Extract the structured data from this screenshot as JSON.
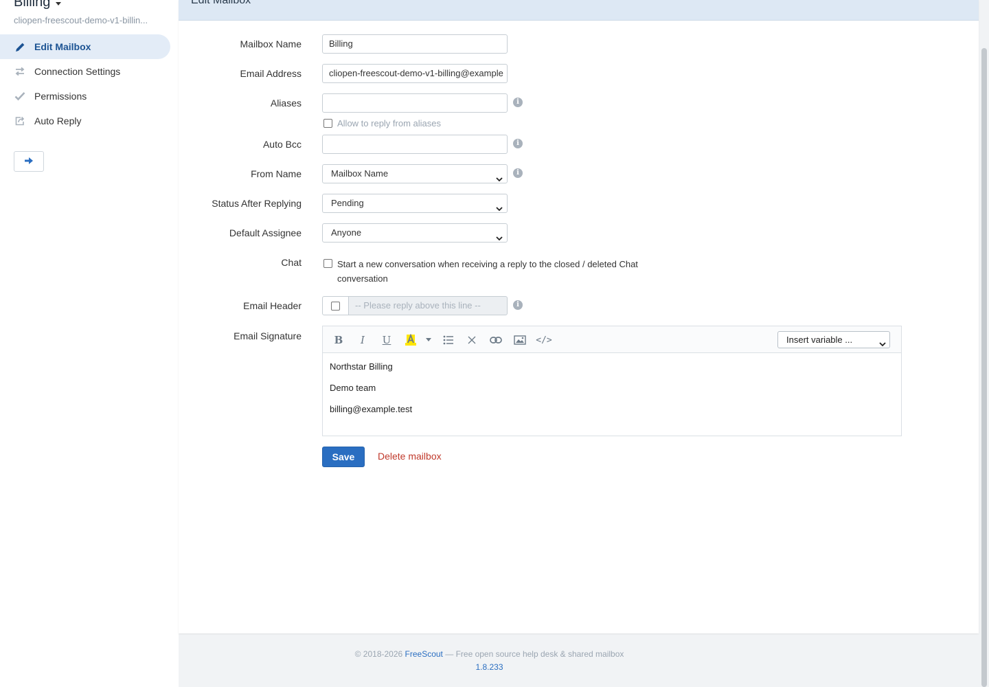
{
  "sidebar": {
    "title": "Billing",
    "subtitle": "cliopen-freescout-demo-v1-billin...",
    "items": [
      {
        "label": "Edit Mailbox",
        "icon": "pencil-icon",
        "active": true
      },
      {
        "label": "Connection Settings",
        "icon": "transfer-icon"
      },
      {
        "label": "Permissions",
        "icon": "check-icon"
      },
      {
        "label": "Auto Reply",
        "icon": "reply-icon"
      }
    ],
    "collapse_icon": "arrow-right-icon"
  },
  "header": {
    "title": "Edit Mailbox"
  },
  "form": {
    "mailbox_name": {
      "label": "Mailbox Name",
      "value": "Billing"
    },
    "email_address": {
      "label": "Email Address",
      "value": "cliopen-freescout-demo-v1-billing@example"
    },
    "aliases": {
      "label": "Aliases",
      "value": "",
      "allow_reply_label": "Allow to reply from aliases"
    },
    "auto_bcc": {
      "label": "Auto Bcc",
      "value": ""
    },
    "from_name": {
      "label": "From Name",
      "value": "Mailbox Name"
    },
    "status_after_replying": {
      "label": "Status After Replying",
      "value": "Pending"
    },
    "default_assignee": {
      "label": "Default Assignee",
      "value": "Anyone"
    },
    "chat": {
      "label": "Chat",
      "option_label_1": "Start a new conversation when receiving a reply to the closed / deleted Chat",
      "option_label_2": "conversation"
    },
    "email_header": {
      "label": "Email Header",
      "placeholder": "-- Please reply above this line --"
    },
    "email_signature": {
      "label": "Email Signature",
      "insert_variable": "Insert variable ...",
      "lines": [
        "Northstar Billing",
        "Demo team",
        "billing@example.test"
      ]
    }
  },
  "actions": {
    "save": "Save",
    "delete": "Delete mailbox"
  },
  "footer": {
    "copyright": "© 2018-2026",
    "brand": "FreeScout",
    "tagline": "— Free open source help desk & shared mailbox",
    "version": "1.8.233"
  },
  "colors": {
    "accent": "#2a6ec1",
    "danger": "#c0392b",
    "active_bg": "#e3ecf7",
    "header_bg": "#dde8f4"
  }
}
